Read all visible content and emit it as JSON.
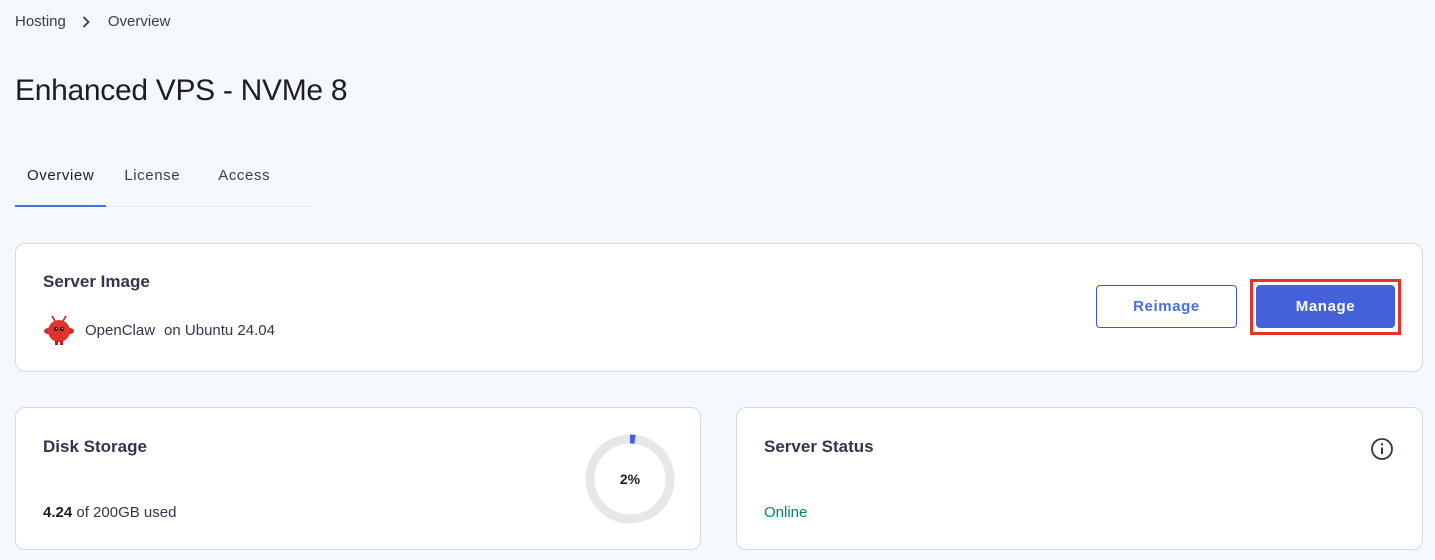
{
  "breadcrumb": {
    "items": [
      "Hosting",
      "Overview"
    ],
    "separator_icon": "chevron-right-icon"
  },
  "page": {
    "title": "Enhanced VPS - NVMe 8"
  },
  "tabs": [
    {
      "label": "Overview",
      "active": true
    },
    {
      "label": "License",
      "active": false
    },
    {
      "label": "Access",
      "active": false
    }
  ],
  "server_image": {
    "title": "Server Image",
    "os_icon": "openclaw-logo-icon",
    "app_name": "OpenClaw",
    "os_text": "on Ubuntu 24.04",
    "reimage_label": "Reimage",
    "manage_label": "Manage"
  },
  "disk": {
    "title": "Disk Storage",
    "used": "4.24",
    "total_text": "of 200GB used",
    "percent_label": "2%",
    "percent_value": 2
  },
  "status": {
    "title": "Server Status",
    "value": "Online",
    "info_icon": "info-icon"
  },
  "colors": {
    "accent": "#4561d9",
    "online": "#00866b",
    "highlight": "#e5322f",
    "background": "#f5f8fc"
  }
}
